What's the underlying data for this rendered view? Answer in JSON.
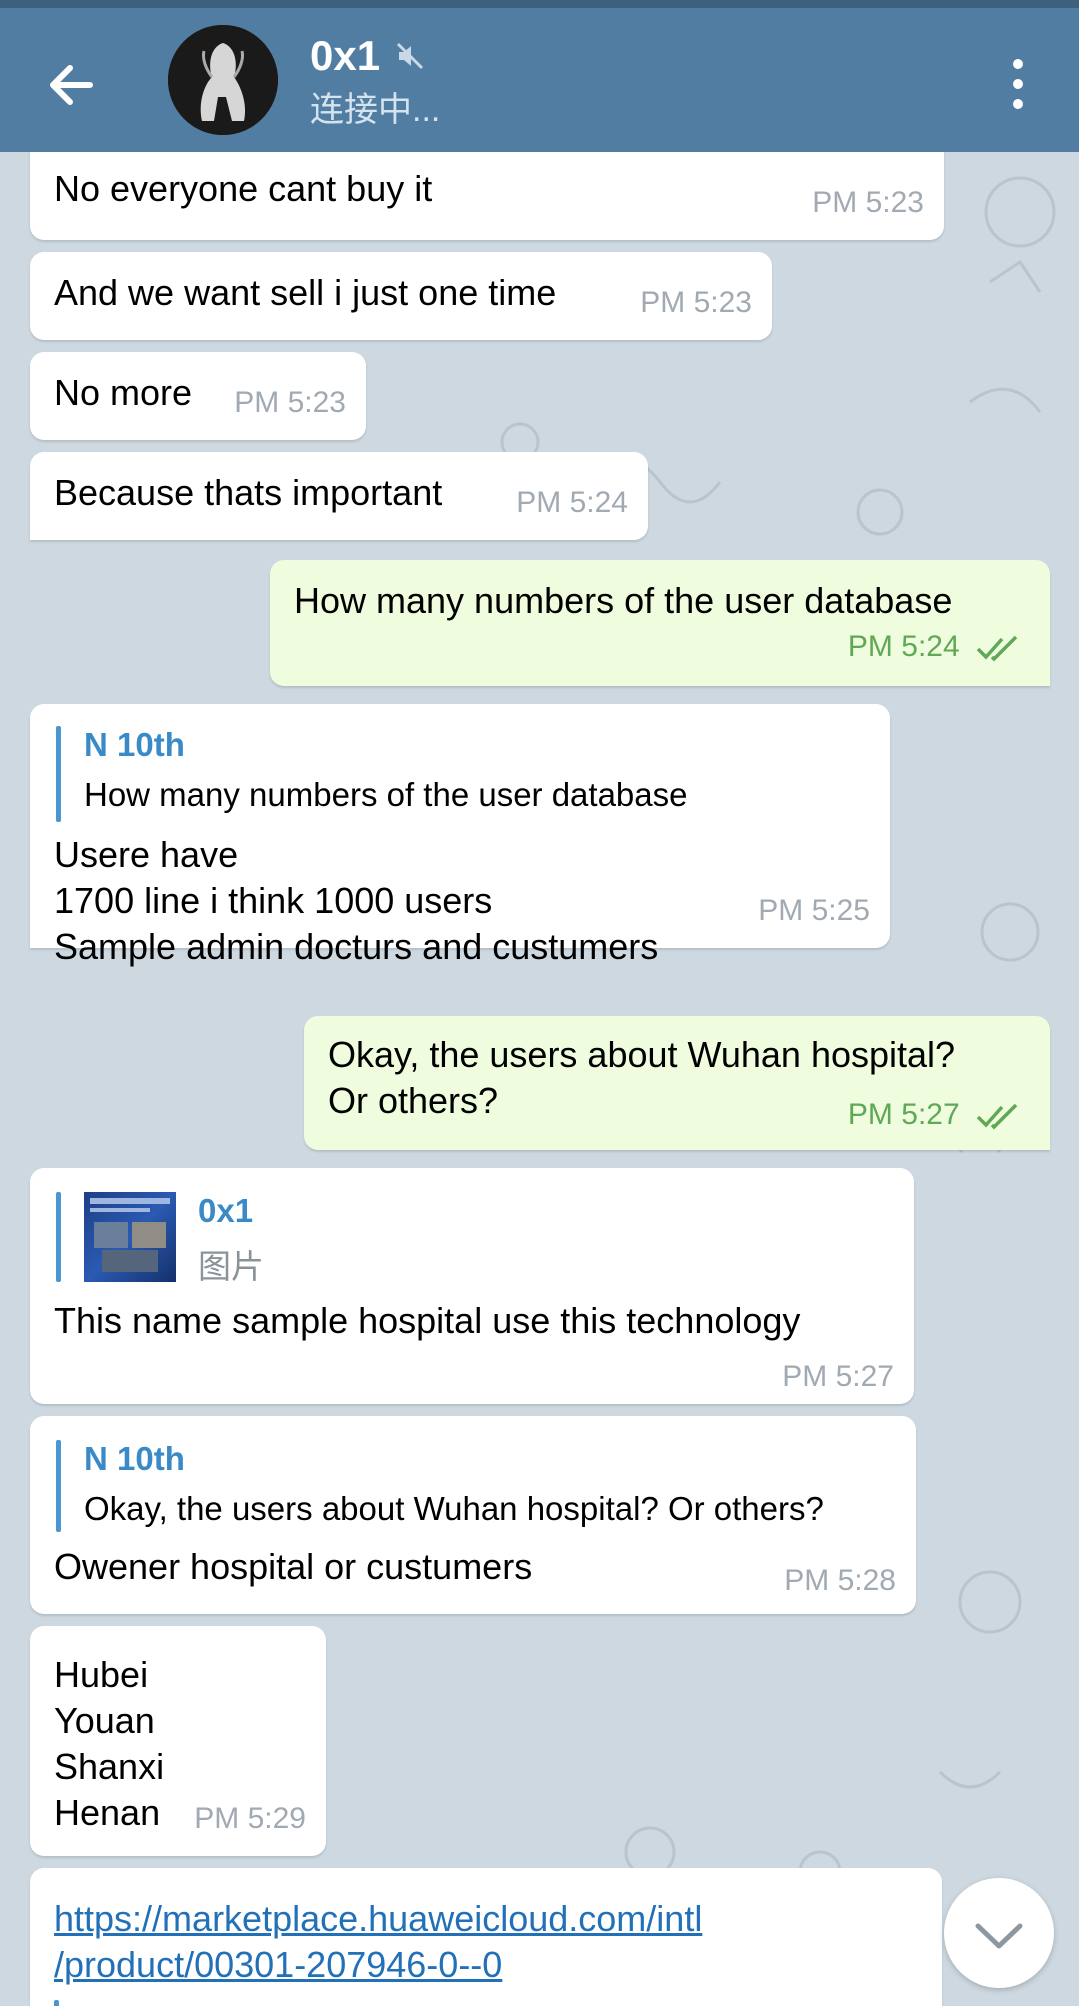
{
  "header": {
    "title": "0x1",
    "status": "连接中...",
    "back_icon": "arrow-left-icon",
    "mute_icon": "speaker-muted-icon",
    "more_icon": "more-vertical-icon"
  },
  "colors": {
    "header_bg": "#527da3",
    "chat_bg": "#cdd8e0",
    "incoming_bubble": "#ffffff",
    "outgoing_bubble": "#effdde",
    "reply_accent": "#3a8ac7",
    "outgoing_time": "#5fa856"
  },
  "messages": [
    {
      "text": "No everyone cant buy it",
      "time": "PM 5:23"
    },
    {
      "text": "And we want sell i just one time",
      "time": "PM 5:23"
    },
    {
      "text": "No more",
      "time": "PM 5:23"
    },
    {
      "text": "Because thats important",
      "time": "PM 5:24"
    },
    {
      "text": "How many numbers of the user database",
      "time": "PM 5:24"
    },
    {
      "reply_name": "N 10th",
      "reply_text": "How many numbers of the user database",
      "text": "Usere have\n1700 line i think 1000 users\nSample admin docturs and custumers",
      "time": "PM 5:25"
    },
    {
      "text": "Okay, the users about Wuhan hospital?\nOr others?",
      "time": "PM 5:27"
    },
    {
      "reply_name": "0x1",
      "reply_text": "图片",
      "text": "This name sample hospital use this technology",
      "time": "PM 5:27"
    },
    {
      "reply_name": "N 10th",
      "reply_text": "Okay, the users about Wuhan hospital? Or others?",
      "text": "Owener hospital or custumers",
      "time": "PM 5:28"
    },
    {
      "text": "Hubei\nYouan\nShanxi\nHenan",
      "time": "PM 5:29"
    },
    {
      "link": "https://marketplace.huaweicloud.com/intl\n/product/00301-207946-0--0"
    }
  ],
  "scroll_down_icon": "chevron-down-icon"
}
